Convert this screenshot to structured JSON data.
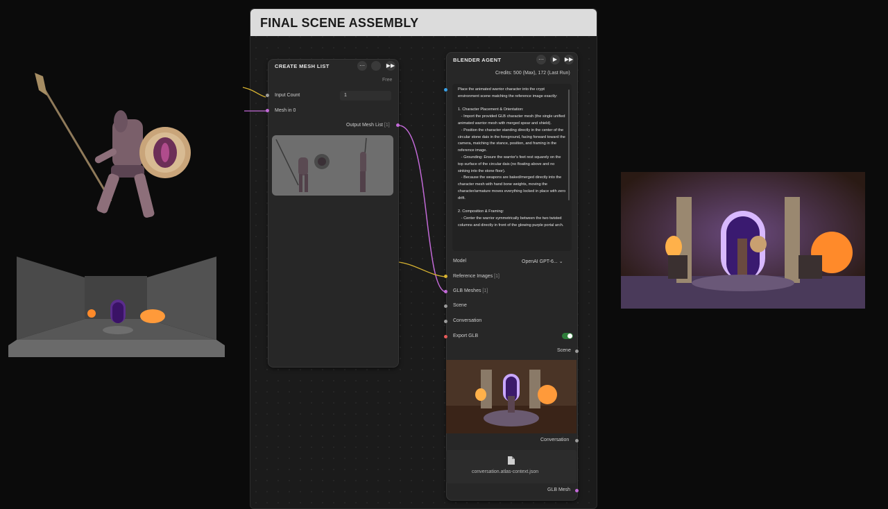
{
  "group": {
    "title": "FINAL SCENE ASSEMBLY"
  },
  "create_mesh_list": {
    "title": "CREATE MESH LIST",
    "menu_glyph": "···",
    "run_glyph": "▶▶",
    "pricing": "Free",
    "input_count_label": "Input Count",
    "input_count_value": "1",
    "mesh_input_label": "Mesh in 0",
    "output_label": "Output Mesh List",
    "output_badge": "[1]"
  },
  "blender_agent": {
    "title": "BLENDER AGENT",
    "menu_glyph": "···",
    "play_glyph": "▶",
    "run_glyph": "▶▶",
    "credits": "Credits: 500 (Max), 172 (Last Run)",
    "prompt": "Place the animated warrior character into the crypt environment scene matching the reference image exactly:\n\n1. Character Placement & Orientation:\n   - Import the provided GLB character mesh (the single unified animated warrior mesh with merged spear and shield).\n   - Position the character standing directly in the center of the circular stone dais in the foreground, facing forward toward the camera, matching the stance, position, and framing in the reference image.\n   - Grounding: Ensure the warrior's feet rest squarely on the top surface of the circular dais (no floating above and no sinking into the stone floor).\n   - Because the weapons are baked/merged directly into the character mesh with hand bone weights, moving the character/armature moves everything locked in place with zero drift.\n\n2. Composition & Framing:\n   - Center the warrior symmetrically between the two twisted columns and directly in front of the glowing purple portal arch.",
    "model_label": "Model",
    "model_value": "OpenAI GPT-6...",
    "ref_images_label": "Reference Images",
    "ref_images_badge": "[1]",
    "glb_meshes_label": "GLB Meshes",
    "glb_meshes_badge": "[1]",
    "scene_label": "Scene",
    "conversation_label": "Conversation",
    "export_glb_label": "Export GLB",
    "export_glb_on": true,
    "out_scene_label": "Scene",
    "out_conversation_label": "Conversation",
    "file_name": "conversation.atlas-context.json",
    "out_glb_label": "GLB Mesh"
  },
  "colors": {
    "mesh_port": "#c36ad8",
    "image_port": "#d9b431",
    "neutral_port": "#9a9a9a",
    "text_port": "#39a0e6",
    "bool_port": "#e85a5a",
    "toggle_on": "#2e7d3a"
  },
  "icons": {
    "warrior": "warrior-render",
    "crypt": "crypt-environment-render",
    "reference": "reference-image",
    "file": "document-icon"
  }
}
